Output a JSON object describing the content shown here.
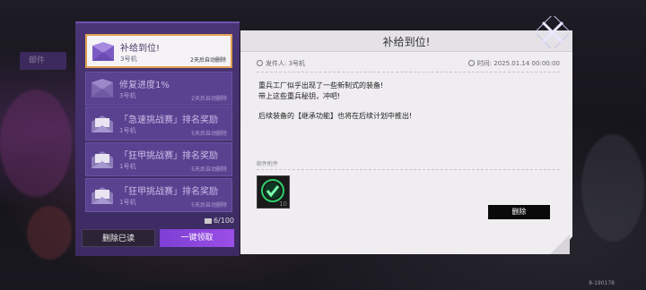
{
  "background": {
    "tab_label": "邮件"
  },
  "mail_list": {
    "items": [
      {
        "title": "补给到位!",
        "sender": "3号机",
        "expire": "2天后自动删除",
        "selected": true
      },
      {
        "title": "修复进度1%",
        "sender": "3号机",
        "expire": "2天后自动删除",
        "selected": false
      },
      {
        "title": "「急速挑战赛」排名奖励",
        "sender": "1号机",
        "expire": "5天后自动删除",
        "selected": false
      },
      {
        "title": "「狂甲挑战赛」排名奖励",
        "sender": "1号机",
        "expire": "5天后自动删除",
        "selected": false
      },
      {
        "title": "「狂甲挑战赛」排名奖励",
        "sender": "1号机",
        "expire": "5天后自动删除",
        "selected": false
      }
    ],
    "count": "6/100",
    "delete_read_label": "删除已读",
    "collect_all_label": "一键领取"
  },
  "detail": {
    "title": "补给到位!",
    "sender": "发件人: 3号机",
    "time": "时间: 2025.01.14 00:00:00",
    "body_line1": "重兵工厂似乎出现了一些新制式的装备!",
    "body_line2": "带上这些重兵秘钥，冲吧!",
    "body_line3": "后续装备的【继承功能】也将在后续计划中推出!",
    "attachments_label": "邮件附件",
    "attachment_qty": "10",
    "delete_label": "删除"
  },
  "build_id": "8-190178",
  "colors": {
    "panel": "#4a3574",
    "accent": "#9b4fe6",
    "selected_border": "#e2a153",
    "paper": "#efedf0"
  }
}
